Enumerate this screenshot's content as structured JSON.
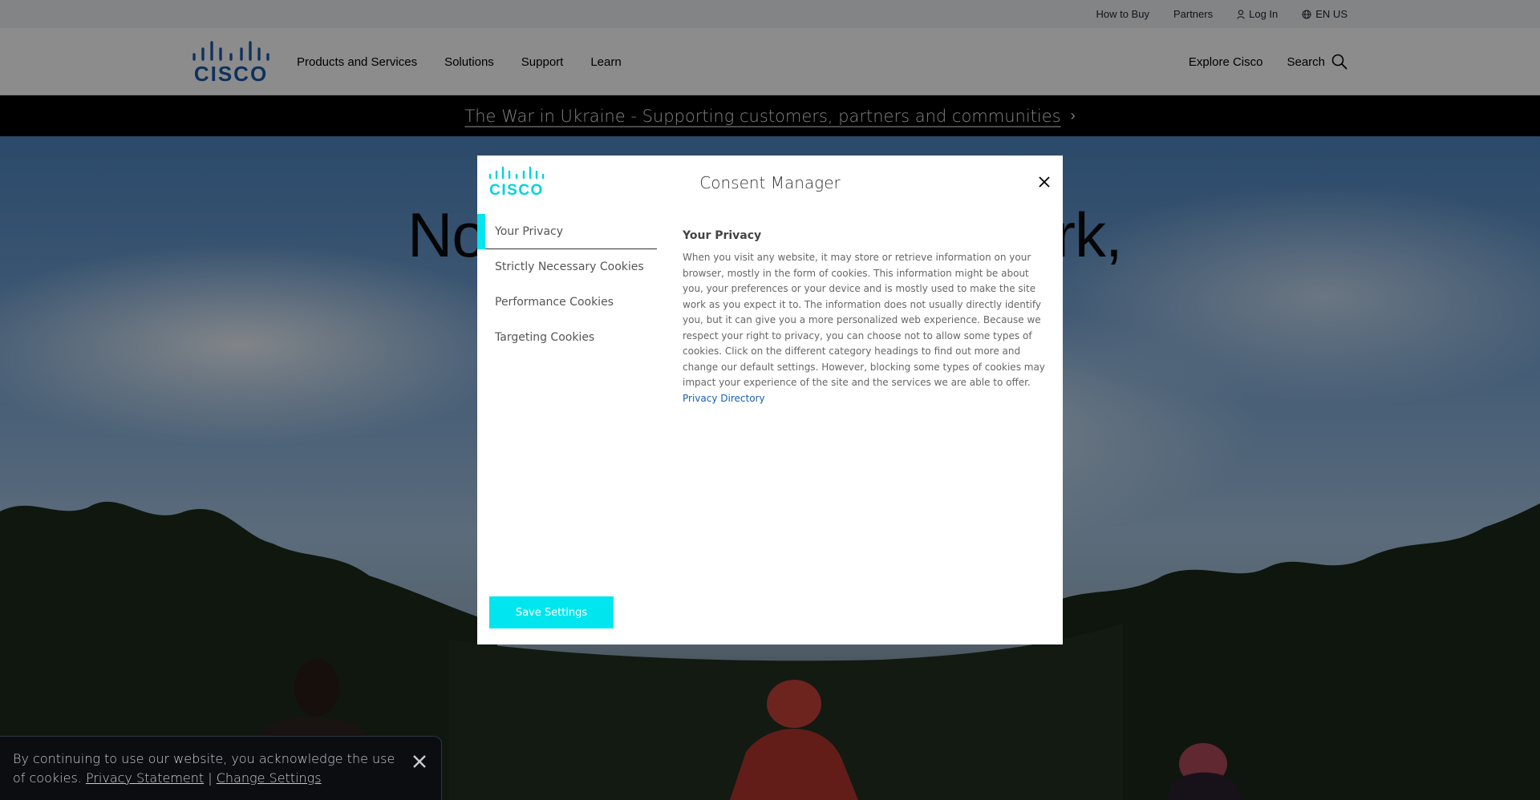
{
  "utility": {
    "how_to_buy": "How to Buy",
    "partners": "Partners",
    "login": "Log In",
    "language": "EN US"
  },
  "nav": {
    "logo_text": "CISCO",
    "items": [
      {
        "label": "Products and Services"
      },
      {
        "label": "Solutions"
      },
      {
        "label": "Support"
      },
      {
        "label": "Learn"
      }
    ],
    "explore": "Explore Cisco",
    "search": "Search"
  },
  "banner": {
    "text": "The War in Ukraine - Supporting customers, partners and communities"
  },
  "hero": {
    "headline_left": "No",
    "headline_right": "rk,"
  },
  "modal": {
    "title": "Consent Manager",
    "tabs": [
      {
        "label": "Your Privacy"
      },
      {
        "label": "Strictly Necessary Cookies"
      },
      {
        "label": "Performance Cookies"
      },
      {
        "label": "Targeting Cookies"
      }
    ],
    "content": {
      "heading": "Your Privacy",
      "body": "When you visit any website, it may store or retrieve information on your browser, mostly in the form of cookies. This information might be about you, your preferences or your device and is mostly used to make the site work as you expect it to. The information does not usually directly identify you, but it can give you a more personalized web experience. Because we respect your right to privacy, you can choose not to allow some types of cookies. Click on the different category headings to find out more and change our default settings. However, blocking some types of cookies may impact your experience of the site and the services we are able to offer.",
      "link": "Privacy Directory"
    },
    "save_label": "Save Settings"
  },
  "cookie_toast": {
    "text_before": "By continuing to use our website, you acknowledge the use of cookies.",
    "privacy_link": "Privacy Statement",
    "separator": "|",
    "settings_link": "Change Settings"
  },
  "colors": {
    "accent": "#00e6ee",
    "cisco_blue": "#1d5aa8",
    "link": "#1a5fb4"
  }
}
